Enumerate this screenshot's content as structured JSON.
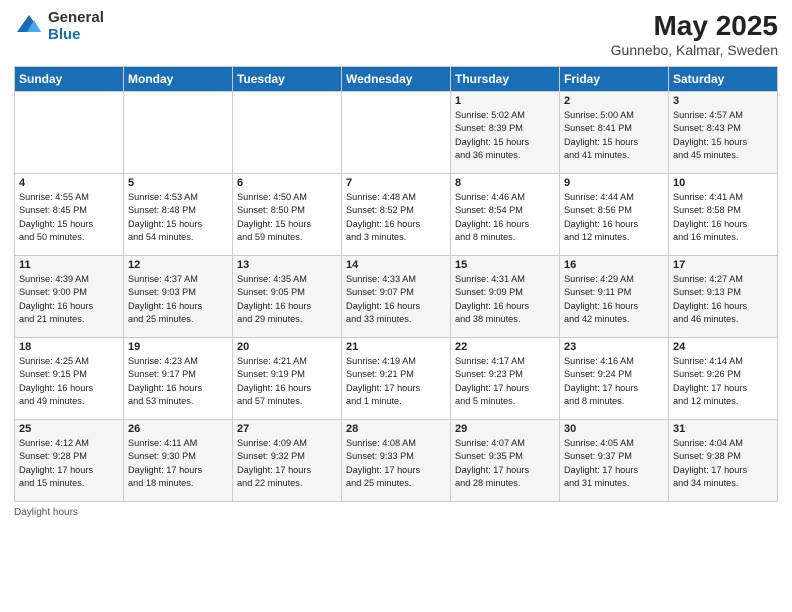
{
  "header": {
    "logo_general": "General",
    "logo_blue": "Blue",
    "title": "May 2025",
    "subtitle": "Gunnebo, Kalmar, Sweden"
  },
  "columns": [
    "Sunday",
    "Monday",
    "Tuesday",
    "Wednesday",
    "Thursday",
    "Friday",
    "Saturday"
  ],
  "weeks": [
    [
      {
        "day": "",
        "info": ""
      },
      {
        "day": "",
        "info": ""
      },
      {
        "day": "",
        "info": ""
      },
      {
        "day": "",
        "info": ""
      },
      {
        "day": "1",
        "info": "Sunrise: 5:02 AM\nSunset: 8:39 PM\nDaylight: 15 hours\nand 36 minutes."
      },
      {
        "day": "2",
        "info": "Sunrise: 5:00 AM\nSunset: 8:41 PM\nDaylight: 15 hours\nand 41 minutes."
      },
      {
        "day": "3",
        "info": "Sunrise: 4:57 AM\nSunset: 8:43 PM\nDaylight: 15 hours\nand 45 minutes."
      }
    ],
    [
      {
        "day": "4",
        "info": "Sunrise: 4:55 AM\nSunset: 8:45 PM\nDaylight: 15 hours\nand 50 minutes."
      },
      {
        "day": "5",
        "info": "Sunrise: 4:53 AM\nSunset: 8:48 PM\nDaylight: 15 hours\nand 54 minutes."
      },
      {
        "day": "6",
        "info": "Sunrise: 4:50 AM\nSunset: 8:50 PM\nDaylight: 15 hours\nand 59 minutes."
      },
      {
        "day": "7",
        "info": "Sunrise: 4:48 AM\nSunset: 8:52 PM\nDaylight: 16 hours\nand 3 minutes."
      },
      {
        "day": "8",
        "info": "Sunrise: 4:46 AM\nSunset: 8:54 PM\nDaylight: 16 hours\nand 8 minutes."
      },
      {
        "day": "9",
        "info": "Sunrise: 4:44 AM\nSunset: 8:56 PM\nDaylight: 16 hours\nand 12 minutes."
      },
      {
        "day": "10",
        "info": "Sunrise: 4:41 AM\nSunset: 8:58 PM\nDaylight: 16 hours\nand 16 minutes."
      }
    ],
    [
      {
        "day": "11",
        "info": "Sunrise: 4:39 AM\nSunset: 9:00 PM\nDaylight: 16 hours\nand 21 minutes."
      },
      {
        "day": "12",
        "info": "Sunrise: 4:37 AM\nSunset: 9:03 PM\nDaylight: 16 hours\nand 25 minutes."
      },
      {
        "day": "13",
        "info": "Sunrise: 4:35 AM\nSunset: 9:05 PM\nDaylight: 16 hours\nand 29 minutes."
      },
      {
        "day": "14",
        "info": "Sunrise: 4:33 AM\nSunset: 9:07 PM\nDaylight: 16 hours\nand 33 minutes."
      },
      {
        "day": "15",
        "info": "Sunrise: 4:31 AM\nSunset: 9:09 PM\nDaylight: 16 hours\nand 38 minutes."
      },
      {
        "day": "16",
        "info": "Sunrise: 4:29 AM\nSunset: 9:11 PM\nDaylight: 16 hours\nand 42 minutes."
      },
      {
        "day": "17",
        "info": "Sunrise: 4:27 AM\nSunset: 9:13 PM\nDaylight: 16 hours\nand 46 minutes."
      }
    ],
    [
      {
        "day": "18",
        "info": "Sunrise: 4:25 AM\nSunset: 9:15 PM\nDaylight: 16 hours\nand 49 minutes."
      },
      {
        "day": "19",
        "info": "Sunrise: 4:23 AM\nSunset: 9:17 PM\nDaylight: 16 hours\nand 53 minutes."
      },
      {
        "day": "20",
        "info": "Sunrise: 4:21 AM\nSunset: 9:19 PM\nDaylight: 16 hours\nand 57 minutes."
      },
      {
        "day": "21",
        "info": "Sunrise: 4:19 AM\nSunset: 9:21 PM\nDaylight: 17 hours\nand 1 minute."
      },
      {
        "day": "22",
        "info": "Sunrise: 4:17 AM\nSunset: 9:23 PM\nDaylight: 17 hours\nand 5 minutes."
      },
      {
        "day": "23",
        "info": "Sunrise: 4:16 AM\nSunset: 9:24 PM\nDaylight: 17 hours\nand 8 minutes."
      },
      {
        "day": "24",
        "info": "Sunrise: 4:14 AM\nSunset: 9:26 PM\nDaylight: 17 hours\nand 12 minutes."
      }
    ],
    [
      {
        "day": "25",
        "info": "Sunrise: 4:12 AM\nSunset: 9:28 PM\nDaylight: 17 hours\nand 15 minutes."
      },
      {
        "day": "26",
        "info": "Sunrise: 4:11 AM\nSunset: 9:30 PM\nDaylight: 17 hours\nand 18 minutes."
      },
      {
        "day": "27",
        "info": "Sunrise: 4:09 AM\nSunset: 9:32 PM\nDaylight: 17 hours\nand 22 minutes."
      },
      {
        "day": "28",
        "info": "Sunrise: 4:08 AM\nSunset: 9:33 PM\nDaylight: 17 hours\nand 25 minutes."
      },
      {
        "day": "29",
        "info": "Sunrise: 4:07 AM\nSunset: 9:35 PM\nDaylight: 17 hours\nand 28 minutes."
      },
      {
        "day": "30",
        "info": "Sunrise: 4:05 AM\nSunset: 9:37 PM\nDaylight: 17 hours\nand 31 minutes."
      },
      {
        "day": "31",
        "info": "Sunrise: 4:04 AM\nSunset: 9:38 PM\nDaylight: 17 hours\nand 34 minutes."
      }
    ]
  ],
  "footer": {
    "daylight_label": "Daylight hours"
  }
}
